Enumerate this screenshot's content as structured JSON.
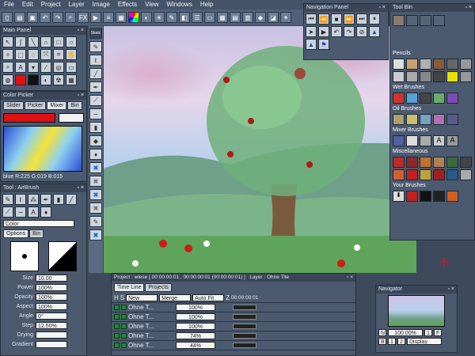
{
  "menu": [
    "File",
    "Edit",
    "Project",
    "Layer",
    "Image",
    "Effects",
    "View",
    "Windows",
    "Help"
  ],
  "toolbar": {
    "fx_label": "FX"
  },
  "panels": {
    "main_panel": "Main Panel",
    "color_picker": "Color Picker",
    "tool": "Tool : AirBrush",
    "navigation": "Navigation Panel",
    "toolbin": "Tool Bin",
    "navigator": "Navigator",
    "side_strip": "Sketc"
  },
  "color_picker": {
    "tabs": [
      "Slider",
      "Picker",
      "Mixer",
      "Bin"
    ],
    "active_tab": "Mixer",
    "current_color": "#dd1111",
    "rgb": "blue R:225 G:019 B:015"
  },
  "tool": {
    "tabs": [
      "Options",
      "Bin"
    ],
    "color_dropdown": "Color",
    "props": [
      {
        "label": "Size",
        "value": "10.00"
      },
      {
        "label": "Power",
        "value": "100%"
      },
      {
        "label": "Opacity",
        "value": "100%"
      },
      {
        "label": "Aspect",
        "value": "100%"
      },
      {
        "label": "Angle",
        "value": "0°"
      },
      {
        "label": "Step",
        "value": "12.50%"
      },
      {
        "label": "Drying",
        "value": ""
      },
      {
        "label": "Gradient",
        "value": ""
      }
    ]
  },
  "toolbin": {
    "sections": [
      "Pencils",
      "Wet Brushes",
      "Oil Brushes",
      "Mixer Brushes",
      "Miscellaneous",
      "Your Brushes"
    ]
  },
  "timeline": {
    "project": "Project : wiese [ 00:00:00:01 , 00:00:00:01 (00:00:00:01) ]",
    "layer": "Layer : Ohne Tite",
    "tabs": [
      "Time Line",
      "Projects"
    ],
    "header": {
      "h": "H",
      "s": "S",
      "new": "New",
      "merge": "Merge",
      "autofit": "Auto Fit",
      "z": "Z",
      "time": "00:00:00:01"
    },
    "rows": [
      {
        "name": "Ohne T...",
        "value": "100%"
      },
      {
        "name": "Ohne T...",
        "value": "100%"
      },
      {
        "name": "Ohne T...",
        "value": "100%"
      },
      {
        "name": "Ohne T...",
        "value": "74%"
      },
      {
        "name": "Ohne T...",
        "value": "44%"
      }
    ]
  },
  "navigator": {
    "zoom": "100.00%",
    "mode": "Display",
    "btn_b": "B",
    "btn_1": "1",
    "btn_2": "2",
    "btn_n": "N",
    "btn_f": "F"
  },
  "colors": {
    "accent": "#dd1111",
    "panel": "#4c5a70",
    "title": "#3a4658"
  }
}
